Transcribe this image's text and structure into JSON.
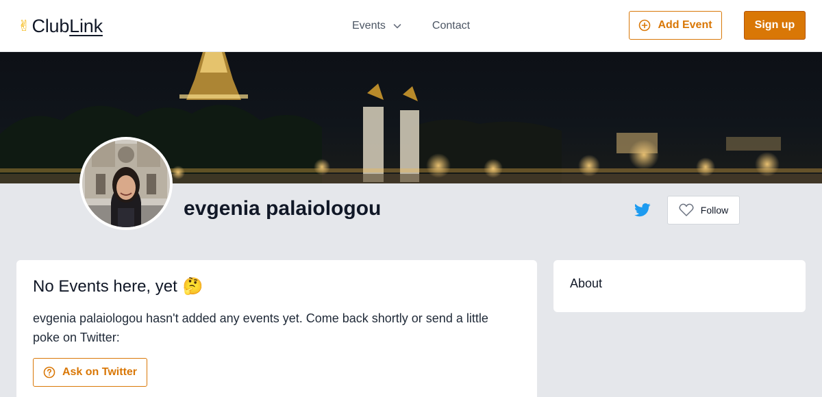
{
  "app": {
    "logo_name": "ClubLink",
    "logo_name_part1": "Club",
    "logo_name_part2": "Link",
    "accent_color": "#d97706"
  },
  "nav": {
    "events_label": "Events",
    "contact_label": "Contact",
    "add_event_label": "Add Event",
    "signup_label": "Sign up"
  },
  "profile": {
    "name": "evgenia palaiologou",
    "follow_label": "Follow",
    "social_icon": "twitter-icon"
  },
  "events_card": {
    "title": "No Events here, yet",
    "emoji": "🤔",
    "message": "evgenia palaiologou hasn't added any events yet. Come back shortly or send a little poke on Twitter:",
    "ask_label": "Ask on Twitter"
  },
  "about_card": {
    "title": "About"
  }
}
